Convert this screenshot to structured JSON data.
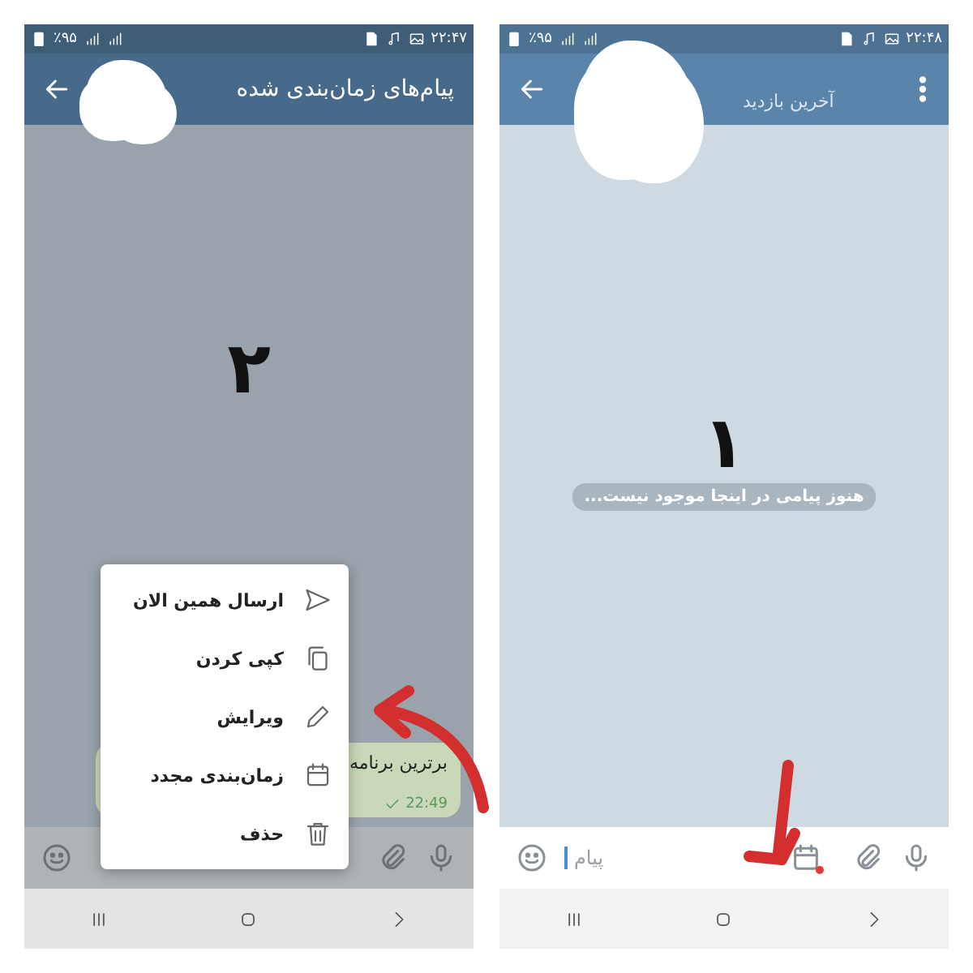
{
  "panels": [
    {
      "step_number": "۱",
      "status_bar": {
        "battery": "٪۹۵",
        "time": "۲۲:۴۸"
      },
      "header": {
        "subtitle": "آخرین بازدید"
      },
      "notice": "هنوز پیامی در اینجا موجود نیست...",
      "input": {
        "placeholder": "پیام",
        "scheduled_indicator": true
      }
    },
    {
      "step_number": "۲",
      "status_bar": {
        "battery": "٪۹۵",
        "time": "۲۲:۴۷"
      },
      "header": {
        "title": "پیام‌های زمان‌بندی شده"
      },
      "message": {
        "text": "برترین برنامه",
        "time": "22:49"
      },
      "context_menu": [
        {
          "kind": "send",
          "label": "ارسال همین الان"
        },
        {
          "kind": "copy",
          "label": "کپی کردن"
        },
        {
          "kind": "edit",
          "label": "ویرایش"
        },
        {
          "kind": "schedule",
          "label": "زمان‌بندی مجدد"
        },
        {
          "kind": "delete",
          "label": "حذف"
        }
      ]
    }
  ]
}
